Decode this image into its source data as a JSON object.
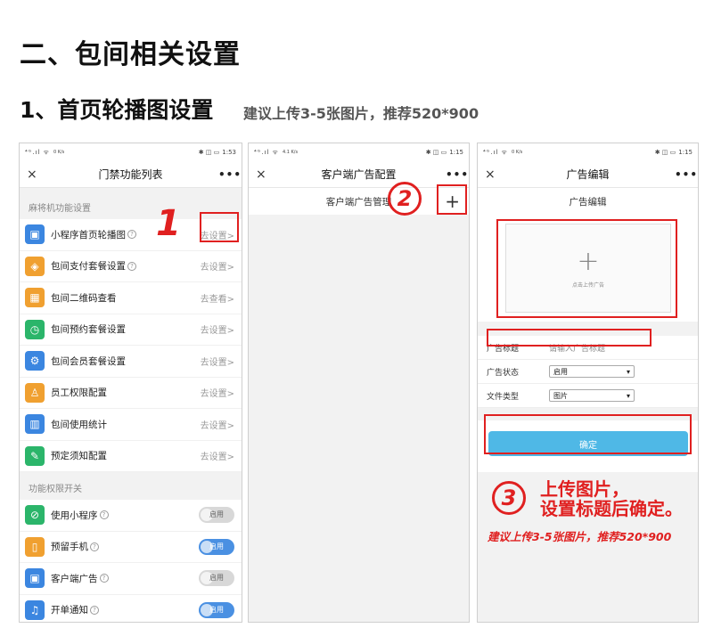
{
  "heading": "二、包间相关设置",
  "subheading": "1、首页轮播图设置",
  "subheading_note": "建议上传3-5张图片，推荐520*900",
  "status_bar": {
    "left_signal": "⁴ᴳ.ıl ᯤ",
    "phone1_time": "1:53",
    "phone2_time": "1:15",
    "phone3_time": "1:15",
    "phone1_speed": "0 K/s",
    "phone2_speed": "4.1 K/s",
    "phone3_speed": "0 K/s",
    "right_icons": "✱ ◫ ▭"
  },
  "phone1": {
    "close": "×",
    "title": "门禁功能列表",
    "more": "•••",
    "section1": "麻将机功能设置",
    "items": [
      {
        "label": "小程序首页轮播图",
        "help": true,
        "action": "去设置>",
        "icon": "▣",
        "color": "#3b86e0"
      },
      {
        "label": "包间支付套餐设置",
        "help": true,
        "action": "去设置>",
        "icon": "◈",
        "color": "#f0a030"
      },
      {
        "label": "包间二维码查看",
        "help": false,
        "action": "去查看>",
        "icon": "▦",
        "color": "#f0a030"
      },
      {
        "label": "包间预约套餐设置",
        "help": false,
        "action": "去设置>",
        "icon": "◷",
        "color": "#2bb56a"
      },
      {
        "label": "包间会员套餐设置",
        "help": false,
        "action": "去设置>",
        "icon": "⚙",
        "color": "#3b86e0"
      },
      {
        "label": "员工权限配置",
        "help": false,
        "action": "去设置>",
        "icon": "♙",
        "color": "#f0a030"
      },
      {
        "label": "包间使用统计",
        "help": false,
        "action": "去设置>",
        "icon": "▥",
        "color": "#3b86e0"
      },
      {
        "label": "预定须知配置",
        "help": false,
        "action": "去设置>",
        "icon": "✎",
        "color": "#2bb56a"
      }
    ],
    "section2": "功能权限开关",
    "switches": [
      {
        "label": "使用小程序",
        "state": "启用",
        "on": false,
        "icon": "⊘",
        "color": "#2bb56a"
      },
      {
        "label": "预留手机",
        "state": "启用",
        "on": true,
        "icon": "▯",
        "color": "#f0a030"
      },
      {
        "label": "客户端广告",
        "state": "启用",
        "on": false,
        "icon": "▣",
        "color": "#3b86e0"
      },
      {
        "label": "开单通知",
        "state": "启用",
        "on": true,
        "icon": "♫",
        "color": "#3b86e0"
      }
    ]
  },
  "phone2": {
    "close": "×",
    "title": "客户端广告配置",
    "more": "•••",
    "subheader": "客户端广告管理",
    "add": "+"
  },
  "phone3": {
    "close": "×",
    "title": "广告编辑",
    "more": "•••",
    "form_title": "广告编辑",
    "upload_plus": "+",
    "upload_text": "点击上传广告",
    "fields": [
      {
        "label": "广告标题",
        "value": "请输入广告标题",
        "type": "text"
      },
      {
        "label": "广告状态",
        "value": "启用",
        "type": "select"
      },
      {
        "label": "文件类型",
        "value": "图片",
        "type": "select"
      }
    ],
    "confirm": "确定"
  },
  "annotations": {
    "step1": "1",
    "step2": "2",
    "step3": "3",
    "step3_line1": "上传图片，",
    "step3_line2": "设置标题后确定。",
    "step3_note": "建议上传3-5张图片，推荐520*900"
  }
}
